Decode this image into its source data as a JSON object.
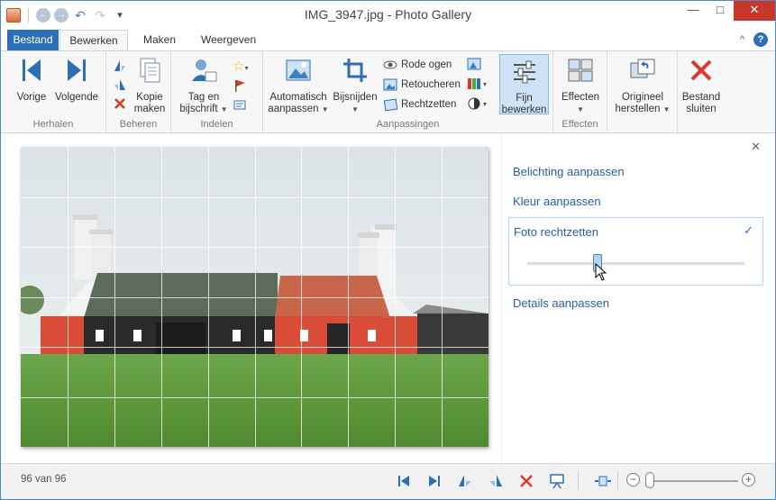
{
  "window": {
    "title": "IMG_3947.jpg - Photo Gallery",
    "minimize_glyph": "—",
    "maximize_glyph": "□",
    "close_glyph": "✕",
    "close_color": "#c7372a"
  },
  "qat": {
    "back_glyph": "←",
    "forward_glyph": "→",
    "undo_glyph": "↶",
    "redo_glyph": "↷",
    "customize_glyph": "▾"
  },
  "tabs": {
    "file": "Bestand",
    "edit": "Bewerken",
    "create": "Maken",
    "view": "Weergeven",
    "collapse_glyph": "^",
    "help_glyph": "?"
  },
  "ribbon": {
    "repeat": {
      "label": "Herhalen",
      "previous": "Vorige",
      "next": "Volgende"
    },
    "manage": {
      "label": "Beheren",
      "copy_line1": "Kopie",
      "copy_line2": "maken"
    },
    "organize": {
      "label": "Indelen",
      "tag_line1": "Tag en",
      "tag_line2": "bijschrift"
    },
    "adjust": {
      "label": "Aanpassingen",
      "auto_line1": "Automatisch",
      "auto_line2": "aanpassen",
      "crop": "Bijsnijden",
      "red_eye": "Rode ogen",
      "retouch": "Retoucheren",
      "straighten": "Rechtzetten",
      "fine_line1": "Fijn",
      "fine_line2": "bewerken"
    },
    "effects": {
      "label": "Effecten",
      "button": "Effecten"
    },
    "revert": {
      "line1": "Origineel",
      "line2": "herstellen"
    },
    "close_file": {
      "line1": "Bestand",
      "line2": "sluiten"
    },
    "accent": "#2d6fb7"
  },
  "panel": {
    "close_glyph": "✕",
    "exposure": "Belichting aanpassen",
    "color": "Kleur aanpassen",
    "straighten": "Foto rechtzetten",
    "details": "Details aanpassen",
    "check_glyph": "✓",
    "straighten_slider_value": 0.32,
    "link_color": "#2b5d9a"
  },
  "status": {
    "count": "96 van 96",
    "zoom_minus": "−",
    "zoom_plus": "+",
    "zoom_level": 0.04
  }
}
